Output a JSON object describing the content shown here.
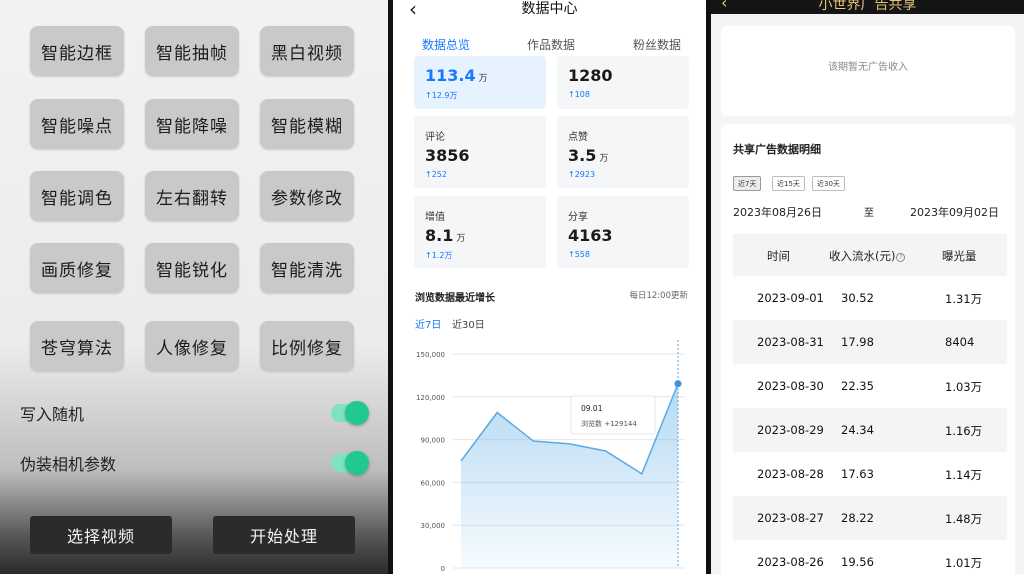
{
  "panel1": {
    "buttons": [
      "智能边框",
      "智能抽帧",
      "黑白视频",
      "智能噪点",
      "智能降噪",
      "智能模糊",
      "智能调色",
      "左右翻转",
      "参数修改",
      "画质修复",
      "智能锐化",
      "智能清洗",
      "苍穹算法",
      "人像修复",
      "比例修复"
    ],
    "toggles": [
      {
        "label": "写入随机",
        "on": true
      },
      {
        "label": "伪装相机参数",
        "on": true
      }
    ],
    "select_video": "选择视频",
    "start_process": "开始处理",
    "accent_color": "#21c98f"
  },
  "panel2": {
    "title": "数据中心",
    "back_icon": "chevron-left-icon",
    "tabs": [
      {
        "label": "数据总览",
        "active": true
      },
      {
        "label": "作品数据",
        "active": false
      },
      {
        "label": "粉丝数据",
        "active": false
      }
    ],
    "cards": [
      {
        "label": "",
        "value": "113.4",
        "unit": "万",
        "change": "↑12.9万",
        "highlight": true
      },
      {
        "label": "",
        "value": "1280",
        "unit": "",
        "change": "↑108",
        "highlight": false
      },
      {
        "label": "评论",
        "value": "3856",
        "unit": "",
        "change": "↑252",
        "highlight": false
      },
      {
        "label": "点赞",
        "value": "3.5",
        "unit": "万",
        "change": "↑2923",
        "highlight": false
      },
      {
        "label": "增值",
        "value": "8.1",
        "unit": "万",
        "change": "↑1.2万",
        "highlight": false
      },
      {
        "label": "分享",
        "value": "4163",
        "unit": "",
        "change": "↑558",
        "highlight": false
      }
    ],
    "section_title": "浏览数据最近增长",
    "update_note": "每日12:00更新",
    "ranges": [
      {
        "label": "近7日",
        "active": true
      },
      {
        "label": "近30日",
        "active": false
      }
    ],
    "accent_color": "#1677ff"
  },
  "chart_data": {
    "type": "area",
    "title": "",
    "y_ticks": [
      "150,000",
      "120,000",
      "90,000",
      "60,000",
      "30,000",
      "0"
    ],
    "ylim": [
      0,
      150000
    ],
    "series": [
      {
        "values": [
          75000,
          109000,
          89000,
          87000,
          82000,
          66000,
          129144
        ]
      }
    ],
    "tooltip": {
      "date": "09.01",
      "text": "浏览数 +129144"
    },
    "color": "#5aaae6"
  },
  "panel3": {
    "title": "小世界广告共享",
    "empty_text": "该期暂无广告收入",
    "detail_title": "共享广告数据明细",
    "periods": [
      {
        "label": "近7天",
        "selected": true
      },
      {
        "label": "近15天",
        "selected": false
      },
      {
        "label": "近30天",
        "selected": false
      }
    ],
    "date_from": "2023年08月26日",
    "date_sep": "至",
    "date_to": "2023年09月02日",
    "columns": [
      "时间",
      "收入流水(元)",
      "曝光量"
    ],
    "rows": [
      [
        "2023-09-01",
        "30.52",
        "1.31万"
      ],
      [
        "2023-08-31",
        "17.98",
        "8404"
      ],
      [
        "2023-08-30",
        "22.35",
        "1.03万"
      ],
      [
        "2023-08-29",
        "24.34",
        "1.16万"
      ],
      [
        "2023-08-28",
        "17.63",
        "1.14万"
      ],
      [
        "2023-08-27",
        "28.22",
        "1.48万"
      ],
      [
        "2023-08-26",
        "19.56",
        "1.01万"
      ]
    ],
    "accent_color": "#e8c478"
  }
}
